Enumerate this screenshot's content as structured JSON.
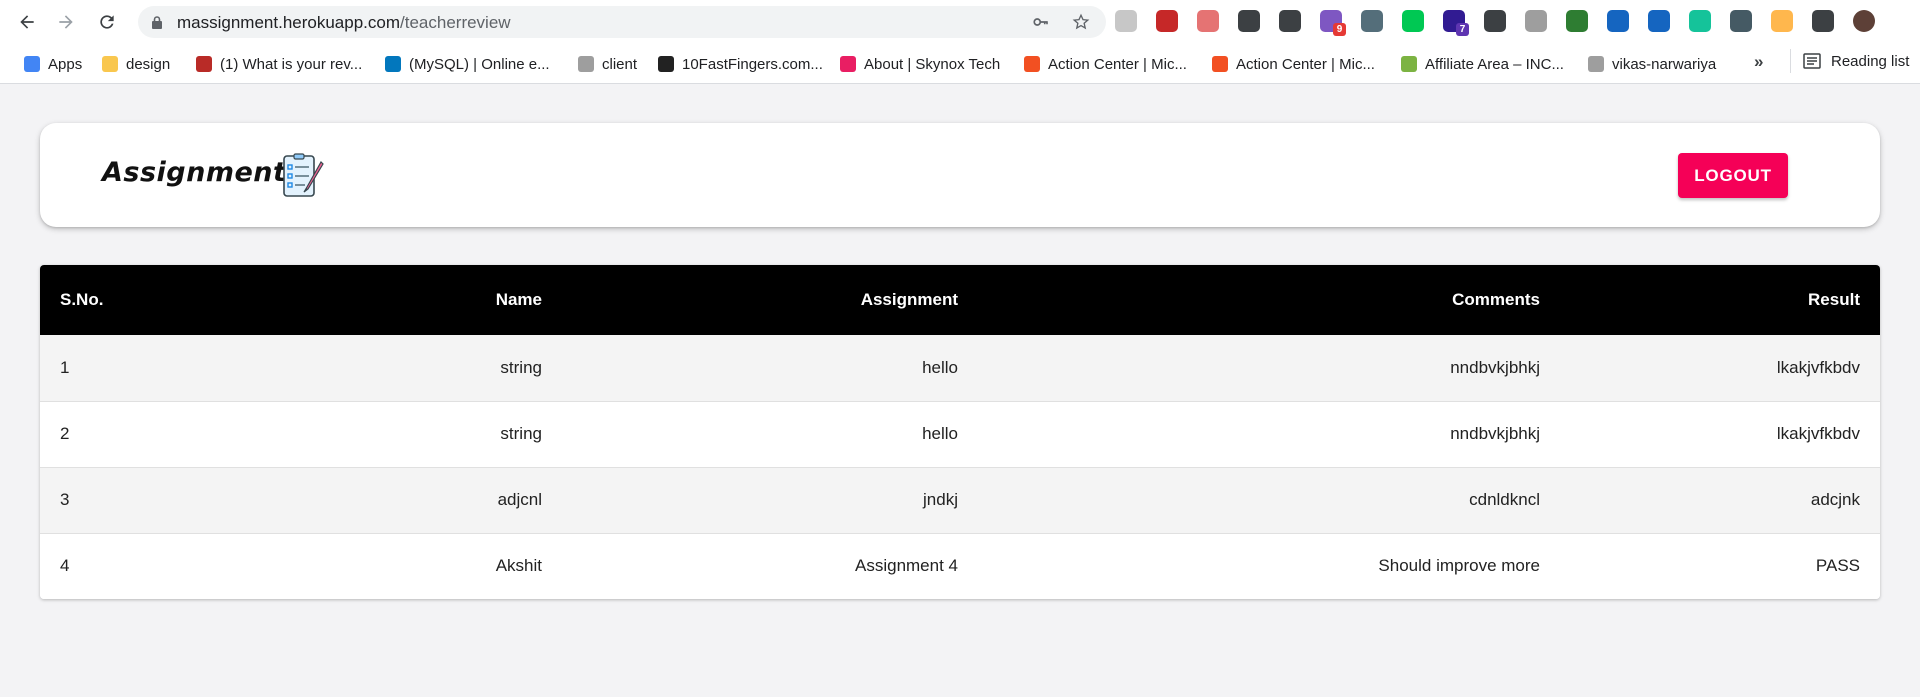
{
  "browser": {
    "url_host": "massignment.herokuapp.com",
    "url_path": "/teacherreview",
    "extensions": [
      {
        "name": "ext-a-icon",
        "color": "#c7c7c7"
      },
      {
        "name": "ext-red-square-icon",
        "color": "#c62828"
      },
      {
        "name": "ext-pink-dots-icon",
        "color": "#e57373"
      },
      {
        "name": "screenshot-icon",
        "color": "#3c4043"
      },
      {
        "name": "braces-icon",
        "color": "#3c4043"
      },
      {
        "name": "ext-purple-badge-icon",
        "color": "#7e57c2",
        "badge": "9"
      },
      {
        "name": "ext-owl-icon",
        "color": "#546e7a"
      },
      {
        "name": "ext-green-icon",
        "color": "#00c853"
      },
      {
        "name": "ext-diamond-icon",
        "color": "#311b92",
        "badge": "7"
      },
      {
        "name": "function-icon",
        "color": "#3c4043"
      },
      {
        "name": "gear-ext-icon",
        "color": "#9e9e9e"
      },
      {
        "name": "code-ext-icon",
        "color": "#2e7d32"
      },
      {
        "name": "feather-icon",
        "color": "#1565c0"
      },
      {
        "name": "react-icon",
        "color": "#1565c0"
      },
      {
        "name": "grammarly-icon",
        "color": "#15c39a"
      },
      {
        "name": "ext-card-icon",
        "color": "#455a64"
      },
      {
        "name": "ext-orange-icon",
        "color": "#ffb74d"
      },
      {
        "name": "puzzle-icon",
        "color": "#3c4043"
      },
      {
        "name": "profile-avatar-icon",
        "color": "#5d4037"
      }
    ]
  },
  "bookmarks": [
    {
      "label": "Apps",
      "icon": "apps-grid-icon",
      "color": "#4285f4"
    },
    {
      "label": "design",
      "icon": "folder-icon",
      "color": "#f9c74f"
    },
    {
      "label": "(1) What is your rev...",
      "icon": "quora-icon",
      "color": "#b92b27"
    },
    {
      "label": "(MySQL) | Online e...",
      "icon": "mysql-icon",
      "color": "#0277bd"
    },
    {
      "label": "client",
      "icon": "github-icon",
      "color": "#9e9e9e"
    },
    {
      "label": "10FastFingers.com...",
      "icon": "fastfingers-icon",
      "color": "#222222"
    },
    {
      "label": "About | Skynox Tech",
      "icon": "skynox-icon",
      "color": "#e91e63"
    },
    {
      "label": "Action Center | Mic...",
      "icon": "microsoft-icon",
      "color": "#f25022"
    },
    {
      "label": "Action Center | Mic...",
      "icon": "microsoft-icon",
      "color": "#f25022"
    },
    {
      "label": "Affiliate Area – INC...",
      "icon": "affiliate-icon",
      "color": "#7cb342"
    },
    {
      "label": "vikas-narwariya",
      "icon": "github-icon",
      "color": "#9e9e9e"
    }
  ],
  "more_bookmarks": "»",
  "reading_list": "Reading list",
  "app": {
    "logo_text": "Assignment",
    "logout_label": "LOGOUT",
    "accent": "#f50057"
  },
  "table": {
    "headers": [
      "S.No.",
      "Name",
      "Assignment",
      "Comments",
      "Result"
    ],
    "rows": [
      [
        "1",
        "string",
        "hello",
        "nndbvkjbhkj",
        "lkakjvfkbdv"
      ],
      [
        "2",
        "string",
        "hello",
        "nndbvkjbhkj",
        "lkakjvfkbdv"
      ],
      [
        "3",
        "adjcnl",
        "jndkj",
        "cdnldkncl",
        "adcjnk"
      ],
      [
        "4",
        "Akshit",
        "Assignment 4",
        "Should improve more",
        "PASS"
      ]
    ]
  }
}
